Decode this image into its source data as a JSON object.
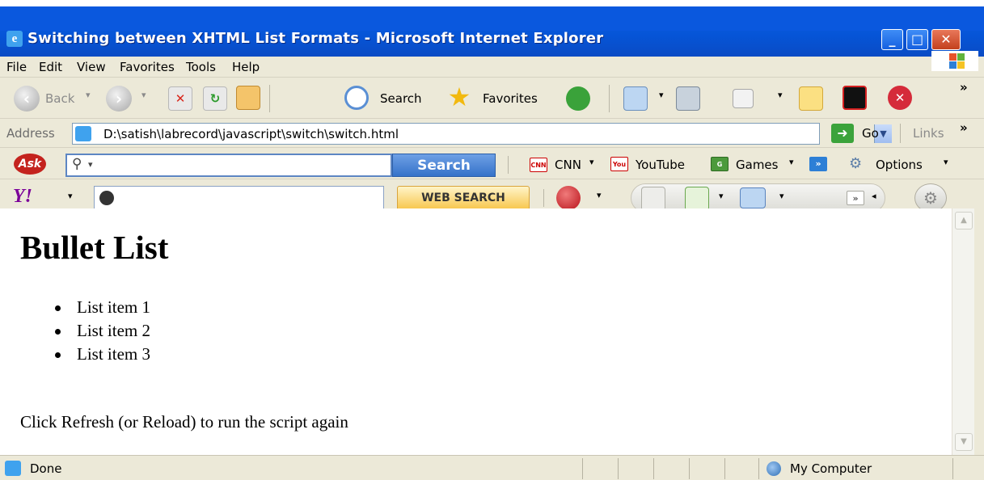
{
  "window": {
    "title": "Switching between XHTML List Formats - Microsoft Internet Explorer",
    "minimize_glyph": "_",
    "maximize_glyph": "□",
    "close_glyph": "✕"
  },
  "menu": {
    "items": [
      "File",
      "Edit",
      "View",
      "Favorites",
      "Tools",
      "Help"
    ]
  },
  "std_toolbar": {
    "back_label": "Back",
    "search_label": "Search",
    "favorites_label": "Favorites",
    "overflow_glyph": "»"
  },
  "address_bar": {
    "label": "Address",
    "value": "D:\\satish\\labrecord\\javascript\\switch\\switch.html",
    "go_label": "Go",
    "links_label": "Links",
    "overflow_glyph": "»"
  },
  "ask_toolbar": {
    "logo_text": "Ask",
    "search_button": "Search",
    "cnn_label": "CNN",
    "youtube_label": "YouTube",
    "games_label": "Games",
    "options_label": "Options"
  },
  "yahoo_toolbar": {
    "logo_text": "Y!",
    "web_search_button": "WEB SEARCH"
  },
  "page": {
    "heading": "Bullet List",
    "list_items": [
      "List item 1",
      "List item 2",
      "List item 3"
    ],
    "paragraph": "Click Refresh (or Reload) to run the script again"
  },
  "status_bar": {
    "status_text": "Done",
    "zone_text": "My Computer"
  },
  "icons": [
    "ie-page-icon",
    "windows-flag-icon",
    "back-icon",
    "forward-icon",
    "stop-icon",
    "refresh-icon",
    "home-icon",
    "search-icon",
    "favorites-star-icon",
    "history-icon",
    "mail-icon",
    "print-icon",
    "edit-icon",
    "note-icon",
    "kaspersky-icon",
    "block-icon",
    "go-arrow-icon",
    "ask-logo-icon",
    "cnn-icon",
    "youtube-icon",
    "games-icon",
    "options-gear-icon",
    "yahoo-logo-icon",
    "my-computer-icon"
  ]
}
